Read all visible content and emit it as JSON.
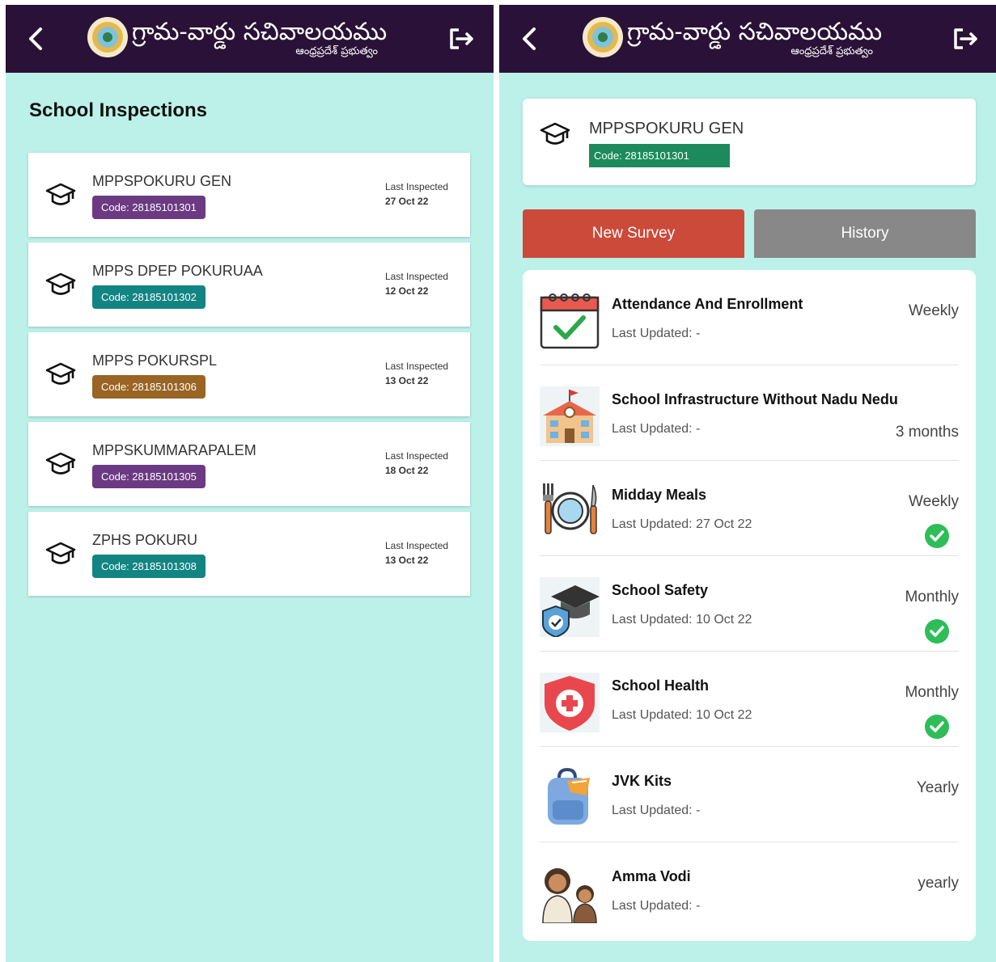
{
  "header": {
    "title": "గ్రామ-వార్డు సచివాలయము",
    "subtitle": "ఆంధ్రప్రదేశ్ ప్రభుత్వం"
  },
  "left_screen": {
    "page_title": "School Inspections",
    "schools": [
      {
        "name": "MPPSPOKURU GEN",
        "code": "Code: 28185101301",
        "badge_color": "#6b3a82",
        "last_inspected_label": "Last Inspected",
        "date": "27 Oct 22"
      },
      {
        "name": "MPPS DPEP POKURUAA",
        "code": "Code: 28185101302",
        "badge_color": "#128583",
        "last_inspected_label": "Last Inspected",
        "date": "12 Oct 22"
      },
      {
        "name": "MPPS POKURSPL",
        "code": "Code: 28185101306",
        "badge_color": "#9a6424",
        "last_inspected_label": "Last Inspected",
        "date": "13 Oct 22"
      },
      {
        "name": "MPPSKUMMARAPALEM",
        "code": "Code: 28185101305",
        "badge_color": "#6b3a82",
        "last_inspected_label": "Last Inspected",
        "date": "18 Oct 22"
      },
      {
        "name": "ZPHS POKURU",
        "code": "Code: 28185101308",
        "badge_color": "#128583",
        "last_inspected_label": "Last Inspected",
        "date": "13 Oct 22"
      }
    ]
  },
  "right_screen": {
    "school_name": "MPPSPOKURU GEN",
    "school_code": "Code: 28185101301",
    "tabs": {
      "new_survey": "New Survey",
      "history": "History"
    },
    "surveys": [
      {
        "title": "Attendance And Enrollment",
        "updated": "Last Updated: -",
        "frequency": "Weekly",
        "done": false,
        "icon": "calendar-check-icon"
      },
      {
        "title": "School Infrastructure Without Nadu Nedu",
        "updated": "Last Updated: -",
        "frequency": "3 months",
        "done": false,
        "icon": "school-building-icon"
      },
      {
        "title": "Midday Meals",
        "updated": "Last Updated: 27 Oct 22",
        "frequency": "Weekly",
        "done": true,
        "icon": "plate-cutlery-icon"
      },
      {
        "title": "School Safety",
        "updated": "Last Updated: 10 Oct 22",
        "frequency": "Monthly",
        "done": true,
        "icon": "safety-shield-cap-icon"
      },
      {
        "title": "School Health",
        "updated": "Last Updated: 10 Oct 22",
        "frequency": "Monthly",
        "done": true,
        "icon": "health-shield-icon"
      },
      {
        "title": "JVK Kits",
        "updated": "Last Updated: -",
        "frequency": "Yearly",
        "done": false,
        "icon": "backpack-icon"
      },
      {
        "title": "Amma Vodi",
        "updated": "Last Updated: -",
        "frequency": "yearly",
        "done": false,
        "icon": "mother-child-icon"
      }
    ]
  },
  "colors": {
    "topbar": "#2a1137",
    "background": "#bcf1e9",
    "new_survey": "#cc4a39",
    "history": "#888888",
    "code_green": "#1d8a5d",
    "check_green": "#2ebd59"
  }
}
